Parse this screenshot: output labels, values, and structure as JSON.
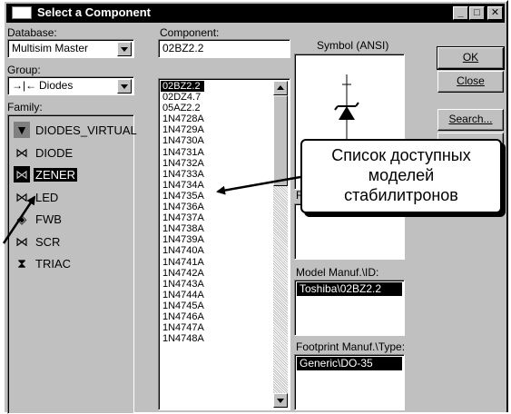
{
  "window": {
    "title": "Select a Component"
  },
  "database": {
    "label": "Database:",
    "value": "Multisim Master"
  },
  "group": {
    "label": "Group:",
    "value": "Diodes"
  },
  "family": {
    "label": "Family:",
    "items": [
      {
        "label": "DIODES_VIRTUAL",
        "icon": "diode-virtual-icon"
      },
      {
        "label": "DIODE",
        "icon": "diode-icon"
      },
      {
        "label": "ZENER",
        "icon": "zener-icon",
        "selected": true
      },
      {
        "label": "LED",
        "icon": "led-icon"
      },
      {
        "label": "FWB",
        "icon": "bridge-rectifier-icon"
      },
      {
        "label": "SCR",
        "icon": "scr-icon"
      },
      {
        "label": "TRIAC",
        "icon": "triac-icon"
      }
    ]
  },
  "component": {
    "label": "Component:",
    "value": "02BZ2.2",
    "items": [
      "02BZ2.2",
      "02DZ4.7",
      "05AZ2.2",
      "1N4728A",
      "1N4729A",
      "1N4730A",
      "1N4731A",
      "1N4732A",
      "1N4733A",
      "1N4734A",
      "1N4735A",
      "1N4736A",
      "1N4737A",
      "1N4738A",
      "1N4739A",
      "1N4740A",
      "1N4741A",
      "1N4742A",
      "1N4743A",
      "1N4744A",
      "1N4745A",
      "1N4746A",
      "1N4747A",
      "1N4748A"
    ]
  },
  "symbol": {
    "label": "Symbol (ANSI)"
  },
  "function": {
    "label": "Fu"
  },
  "model_manuf": {
    "label": "Model Manuf.\\ID:",
    "value": "Toshiba\\02BZ2.2"
  },
  "footprint": {
    "label": "Footprint Manuf.\\Type:",
    "value": "Generic\\DO-35"
  },
  "buttons": {
    "ok": "OK",
    "close": "Close",
    "search": "Search..."
  },
  "callout": {
    "line1": "Список доступных",
    "line2": "моделей",
    "line3": "стабилитронов"
  }
}
